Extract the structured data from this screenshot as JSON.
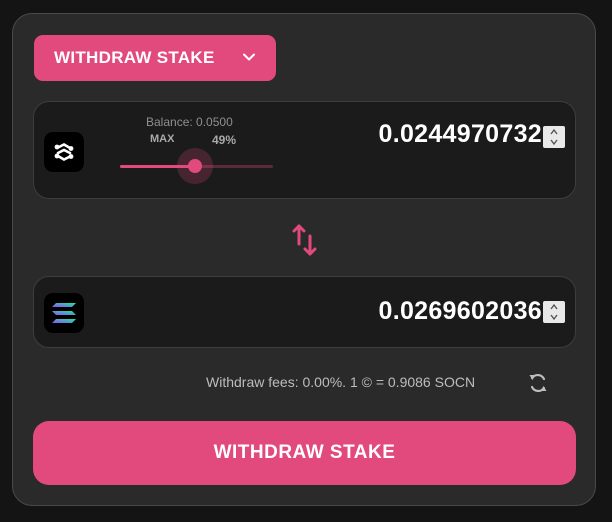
{
  "mode": {
    "label": "WITHDRAW STAKE",
    "icon": "chevron-down-icon"
  },
  "from": {
    "token_icon": "socean-logo-icon",
    "balance_text": "Balance: 0.0500",
    "max_label": "MAX",
    "percent_label": "49%",
    "slider_fraction": 0.49,
    "amount": "0.0244970732"
  },
  "swap_icon": "swap-arrows-icon",
  "to": {
    "token_icon": "solana-logo-icon",
    "amount": "0.0269602036"
  },
  "fees_text": "Withdraw fees: 0.00%. 1 © = 0.9086 SOCN",
  "refresh_icon": "refresh-icon",
  "submit_label": "WITHDRAW STAKE",
  "colors": {
    "accent": "#e2497d",
    "card": "#2b2a2a",
    "panel": "#1c1b1b"
  }
}
